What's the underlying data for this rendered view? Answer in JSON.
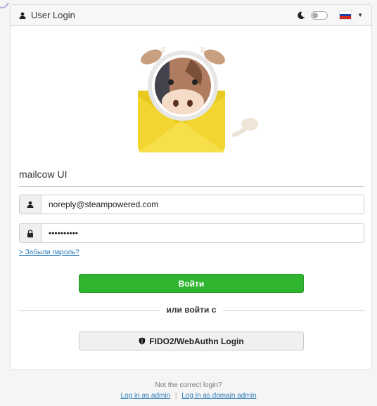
{
  "header": {
    "title": "User Login",
    "user_icon": "user-icon",
    "theme_icon": "moon-icon",
    "language_flag": "russian-flag"
  },
  "app_name": "mailcow UI",
  "form": {
    "username_value": "noreply@steampowered.com",
    "password_value": "••••••••••",
    "forgot_label": "> Забыли пароль?",
    "login_label": "Войти",
    "or_label": "или войти с",
    "fido_label": "FIDO2/WebAuthn Login"
  },
  "footer": {
    "question": "Not the correct login?",
    "admin_link": "Log in as admin",
    "separator": "|",
    "domain_admin_link": "Log in as domain admin"
  },
  "colors": {
    "primary_button": "#2fb52f",
    "link": "#2a7ab9",
    "envelope": "#f2d530",
    "cow_brown": "#b07c60"
  }
}
